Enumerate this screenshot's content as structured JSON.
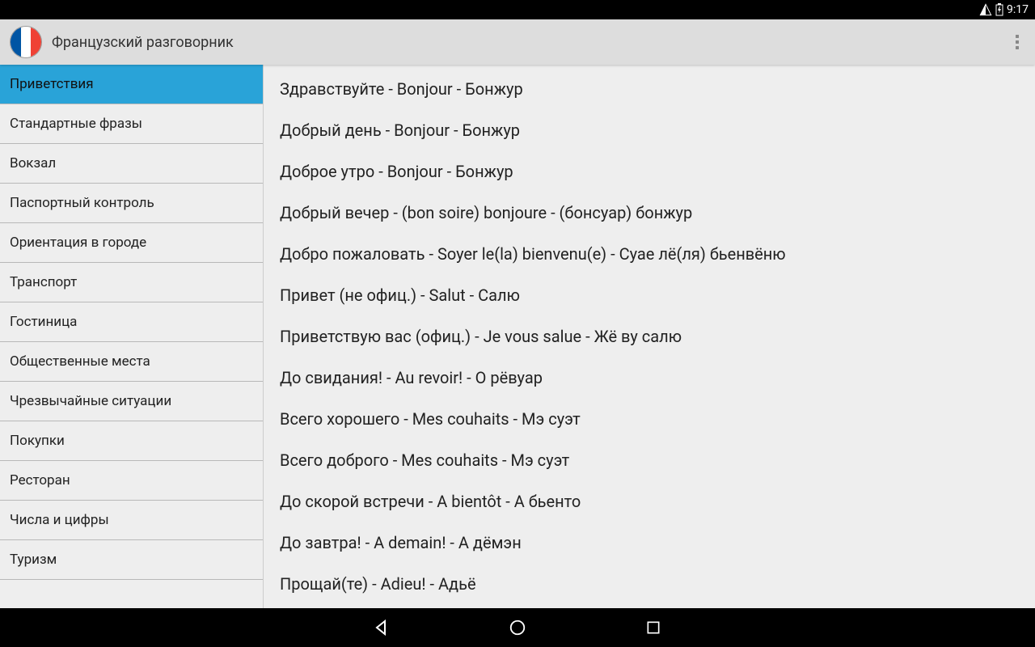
{
  "status": {
    "time": "9:17"
  },
  "header": {
    "title": "Французский разговорник"
  },
  "sidebar": {
    "active_index": 0,
    "items": [
      {
        "label": "Приветствия"
      },
      {
        "label": "Стандартные фразы"
      },
      {
        "label": "Вокзал"
      },
      {
        "label": "Паспортный контроль"
      },
      {
        "label": "Ориентация в городе"
      },
      {
        "label": "Транспорт"
      },
      {
        "label": "Гостиница"
      },
      {
        "label": "Общественные места"
      },
      {
        "label": "Чрезвычайные ситуации"
      },
      {
        "label": "Покупки"
      },
      {
        "label": "Ресторан"
      },
      {
        "label": "Числа и цифры"
      },
      {
        "label": "Туризм"
      }
    ]
  },
  "phrases": [
    {
      "text": "Здравствуйте - Bonjour - Бонжур"
    },
    {
      "text": "Добрый день - Bonjour - Бонжур"
    },
    {
      "text": "Доброе утро - Bonjour - Бонжур"
    },
    {
      "text": "Добрый вечер - (bon soire) bonjoure - (бонсуар) бонжур"
    },
    {
      "text": "Добро пожаловать - Soyer le(la) bienvenu(e) - Суае лё(ля) бьенвёню"
    },
    {
      "text": "Привет (не офиц.) - Salut - Салю"
    },
    {
      "text": "Приветствую вас (офиц.) - Je vous salue - Жё ву салю"
    },
    {
      "text": "До свидания! - Au revoir! - О рёвуар"
    },
    {
      "text": "Всего хорошего - Mes couhaits - Мэ суэт"
    },
    {
      "text": "Всего доброго - Mes couhaits - Мэ суэт"
    },
    {
      "text": "До скорой встречи - A bientôt - А бьенто"
    },
    {
      "text": "До завтра! - A demain! - А дёмэн"
    },
    {
      "text": "Прощай(те) - Adieu! - Адьё"
    }
  ]
}
